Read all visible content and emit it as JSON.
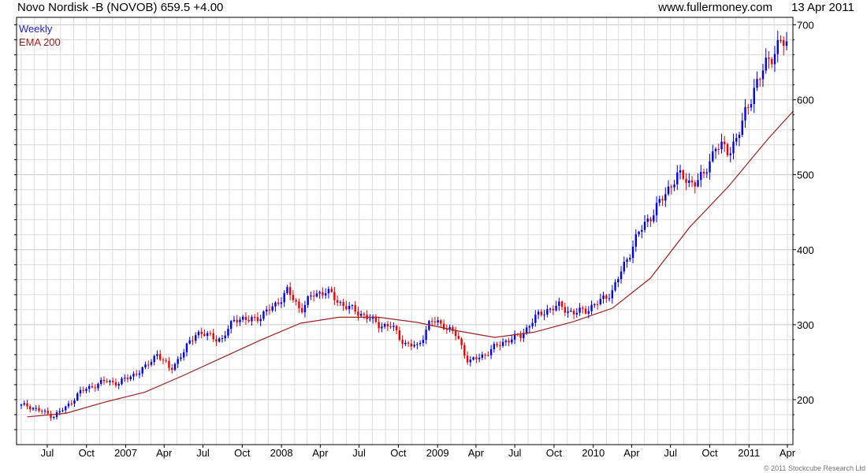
{
  "header": {
    "title": "Novo Nordisk -B (NOVOB) 659.5",
    "change": "+4.00",
    "source": "www.fullermoney.com",
    "date": "13 Apr 2011"
  },
  "legend": [
    {
      "label": "Weekly",
      "color": "#2222cc"
    },
    {
      "label": "EMA 200",
      "color": "#a02020"
    }
  ],
  "colors": {
    "up": "#0000ee",
    "down": "#ee0000",
    "ema": "#a02020",
    "grid": "#dcdcdc",
    "axis": "#000000"
  },
  "copyright": "© 2011 Stockcube Research Ltd",
  "chart_data": {
    "type": "candlestick",
    "frequency": "weekly",
    "ylim": [
      140,
      710
    ],
    "yticks": [
      200,
      300,
      400,
      500,
      600,
      700
    ],
    "ytick_labels": [
      "200",
      "300",
      "400",
      "500",
      "600",
      "700"
    ],
    "xtick_labels": [
      "Jul",
      "Oct",
      "2007",
      "Apr",
      "Jul",
      "Oct",
      "2008",
      "Apr",
      "Jul",
      "Oct",
      "2009",
      "Apr",
      "Jul",
      "Oct",
      "2010",
      "Apr",
      "Jul",
      "Oct",
      "2011",
      "Apr"
    ],
    "grid": true,
    "legend_position": "top-left",
    "series": [
      {
        "name": "Weekly",
        "kind": "candles",
        "x": [
          "2006-05",
          "2006-06",
          "2006-07",
          "2006-08",
          "2006-09",
          "2006-10",
          "2006-11",
          "2006-12",
          "2007-01",
          "2007-02",
          "2007-03",
          "2007-04",
          "2007-05",
          "2007-06",
          "2007-07",
          "2007-08",
          "2007-09",
          "2007-10",
          "2007-11",
          "2007-12",
          "2008-01",
          "2008-02",
          "2008-03",
          "2008-04",
          "2008-05",
          "2008-06",
          "2008-07",
          "2008-08",
          "2008-09",
          "2008-10",
          "2008-11",
          "2008-12",
          "2009-01",
          "2009-02",
          "2009-03",
          "2009-04",
          "2009-05",
          "2009-06",
          "2009-07",
          "2009-08",
          "2009-09",
          "2009-10",
          "2009-11",
          "2009-12",
          "2010-01",
          "2010-02",
          "2010-03",
          "2010-04",
          "2010-05",
          "2010-06",
          "2010-07",
          "2010-08",
          "2010-09",
          "2010-10",
          "2010-11",
          "2010-12",
          "2011-01",
          "2011-02",
          "2011-03",
          "2011-04"
        ],
        "close": [
          192,
          185,
          178,
          190,
          210,
          218,
          225,
          222,
          232,
          242,
          262,
          240,
          262,
          290,
          285,
          280,
          310,
          305,
          312,
          325,
          345,
          320,
          340,
          345,
          330,
          320,
          312,
          300,
          298,
          275,
          270,
          305,
          300,
          285,
          250,
          258,
          270,
          280,
          285,
          308,
          320,
          325,
          315,
          320,
          330,
          345,
          380,
          420,
          445,
          470,
          500,
          490,
          495,
          540,
          530,
          565,
          620,
          650,
          680,
          659.5
        ]
      },
      {
        "name": "EMA 200",
        "kind": "line",
        "x": [
          "2006-05",
          "2006-08",
          "2006-11",
          "2007-02",
          "2007-05",
          "2007-08",
          "2007-11",
          "2008-02",
          "2008-05",
          "2008-08",
          "2008-11",
          "2009-02",
          "2009-05",
          "2009-08",
          "2009-11",
          "2010-02",
          "2010-05",
          "2010-08",
          "2010-11",
          "2011-02",
          "2011-04"
        ],
        "values": [
          177,
          182,
          197,
          210,
          232,
          256,
          280,
          302,
          310,
          310,
          303,
          292,
          283,
          290,
          304,
          322,
          362,
          430,
          485,
          548,
          585
        ]
      }
    ]
  }
}
